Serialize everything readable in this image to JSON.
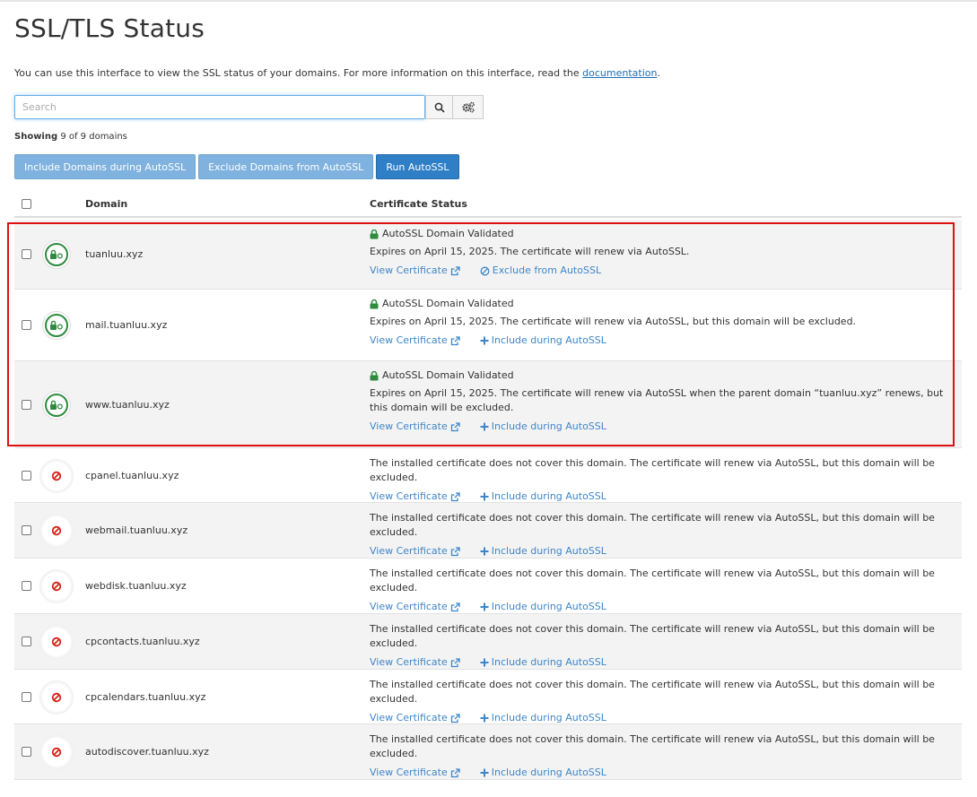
{
  "page": {
    "title": "SSL/TLS Status",
    "intro": "You can use this interface to view the SSL status of your domains. For more information on this interface, read the",
    "intro_link": "documentation",
    "intro_end": "."
  },
  "search": {
    "placeholder": "Search",
    "value": ""
  },
  "showing": {
    "label": "Showing",
    "text": "9 of 9 domains"
  },
  "actions": {
    "include": "Include Domains during AutoSSL",
    "exclude": "Exclude Domains from AutoSSL",
    "run": "Run AutoSSL"
  },
  "table": {
    "headers": {
      "domain": "Domain",
      "status": "Certificate Status"
    },
    "rows": [
      {
        "domain": "tuanluu.xyz",
        "validated": "AutoSSL Domain Validated",
        "message": "Expires on April 15, 2025. The certificate will renew via AutoSSL.",
        "view": "View Certificate",
        "action": "Exclude from AutoSSL"
      },
      {
        "domain": "mail.tuanluu.xyz",
        "validated": "AutoSSL Domain Validated",
        "message": "Expires on April 15, 2025. The certificate will renew via AutoSSL, but this domain will be excluded.",
        "view": "View Certificate",
        "action": "Include during AutoSSL"
      },
      {
        "domain": "www.tuanluu.xyz",
        "validated": "AutoSSL Domain Validated",
        "message": "Expires on April 15, 2025. The certificate will renew via AutoSSL when the parent domain “tuanluu.xyz” renews, but this domain will be excluded.",
        "view": "View Certificate",
        "action": "Include during AutoSSL"
      },
      {
        "domain": "cpanel.tuanluu.xyz",
        "message": "The installed certificate does not cover this domain. The certificate will renew via AutoSSL, but this domain will be excluded.",
        "view": "View Certificate",
        "action": "Include during AutoSSL"
      },
      {
        "domain": "webmail.tuanluu.xyz",
        "message": "The installed certificate does not cover this domain. The certificate will renew via AutoSSL, but this domain will be excluded.",
        "view": "View Certificate",
        "action": "Include during AutoSSL"
      },
      {
        "domain": "webdisk.tuanluu.xyz",
        "message": "The installed certificate does not cover this domain. The certificate will renew via AutoSSL, but this domain will be excluded.",
        "view": "View Certificate",
        "action": "Include during AutoSSL"
      },
      {
        "domain": "cpcontacts.tuanluu.xyz",
        "message": "The installed certificate does not cover this domain. The certificate will renew via AutoSSL, but this domain will be excluded.",
        "view": "View Certificate",
        "action": "Include during AutoSSL"
      },
      {
        "domain": "cpcalendars.tuanluu.xyz",
        "message": "The installed certificate does not cover this domain. The certificate will renew via AutoSSL, but this domain will be excluded.",
        "view": "View Certificate",
        "action": "Include during AutoSSL"
      },
      {
        "domain": "autodiscover.tuanluu.xyz",
        "message": "The installed certificate does not cover this domain. The certificate will renew via AutoSSL, but this domain will be excluded.",
        "view": "View Certificate",
        "action": "Include during AutoSSL"
      }
    ]
  },
  "colors": {
    "ok": "#2e8b3e",
    "error": "#d9201a",
    "link": "#3f86c8",
    "highlight": "#e01010"
  },
  "icons": {
    "ok": "lock-refresh-icon",
    "error": "ban-icon",
    "view": "external-link-icon",
    "exclude": "ban-icon",
    "include": "plus-icon"
  }
}
